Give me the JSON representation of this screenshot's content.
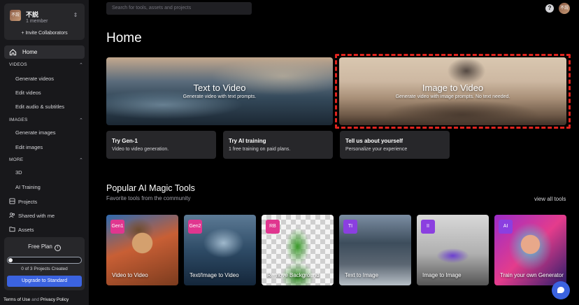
{
  "workspace": {
    "avatar": "不説",
    "name": "不説",
    "members": "1 member",
    "invite": "+ Invite Collaborators"
  },
  "nav": {
    "home": "Home",
    "sections": [
      {
        "title": "VIDEOS",
        "items": [
          "Generate videos",
          "Edit videos",
          "Edit audio & subtitles"
        ]
      },
      {
        "title": "IMAGES",
        "items": [
          "Generate images",
          "Edit images"
        ]
      },
      {
        "title": "MORE",
        "items": [
          "3D",
          "AI Training"
        ]
      }
    ],
    "projects": "Projects",
    "shared": "Shared with me",
    "assets": "Assets"
  },
  "plan": {
    "title": "Free Plan",
    "info": "i",
    "count": "0 of 3 Projects Created",
    "progress": 0,
    "upgrade": "Upgrade to Standard"
  },
  "footer": {
    "terms": "Terms of Use",
    "and": "and",
    "privacy": "Privacy Policy"
  },
  "search": {
    "placeholder": "Search for tools, assets and projects"
  },
  "header": {
    "help": "?",
    "avatar": "不説"
  },
  "page": {
    "title": "Home"
  },
  "hero": [
    {
      "title": "Text to Video",
      "subtitle": "Generate video with text prompts."
    },
    {
      "title": "Image to Video",
      "subtitle": "Generate video with image prompts. No text needed."
    }
  ],
  "mini_cards": [
    {
      "title": "Try Gen-1",
      "subtitle": "Video to video generation."
    },
    {
      "title": "Try AI training",
      "subtitle": "1 free training on paid plans."
    },
    {
      "title": "Tell us about yourself",
      "subtitle": "Personalize your experience"
    }
  ],
  "tools": {
    "title": "Popular AI Magic Tools",
    "subtitle": "Favorite tools from the community",
    "view_all": "view all tools",
    "items": [
      {
        "badge": "Gen1",
        "label": "Video to Video",
        "color": "#e0368f"
      },
      {
        "badge": "Gen2",
        "label": "Text/Image to Video",
        "color": "#e0368f"
      },
      {
        "badge": "RB",
        "label": "Remove Background",
        "color": "#e0368f"
      },
      {
        "badge": "TI",
        "label": "Text to Image",
        "color": "#8b3fe0"
      },
      {
        "badge": "II",
        "label": "Image to Image",
        "color": "#8b3fe0"
      },
      {
        "badge": "AI",
        "label": "Train your own Generator",
        "color": "#8b3fe0"
      }
    ]
  },
  "colors": {
    "accent": "#3b63e0",
    "highlight": "#e0241e"
  }
}
